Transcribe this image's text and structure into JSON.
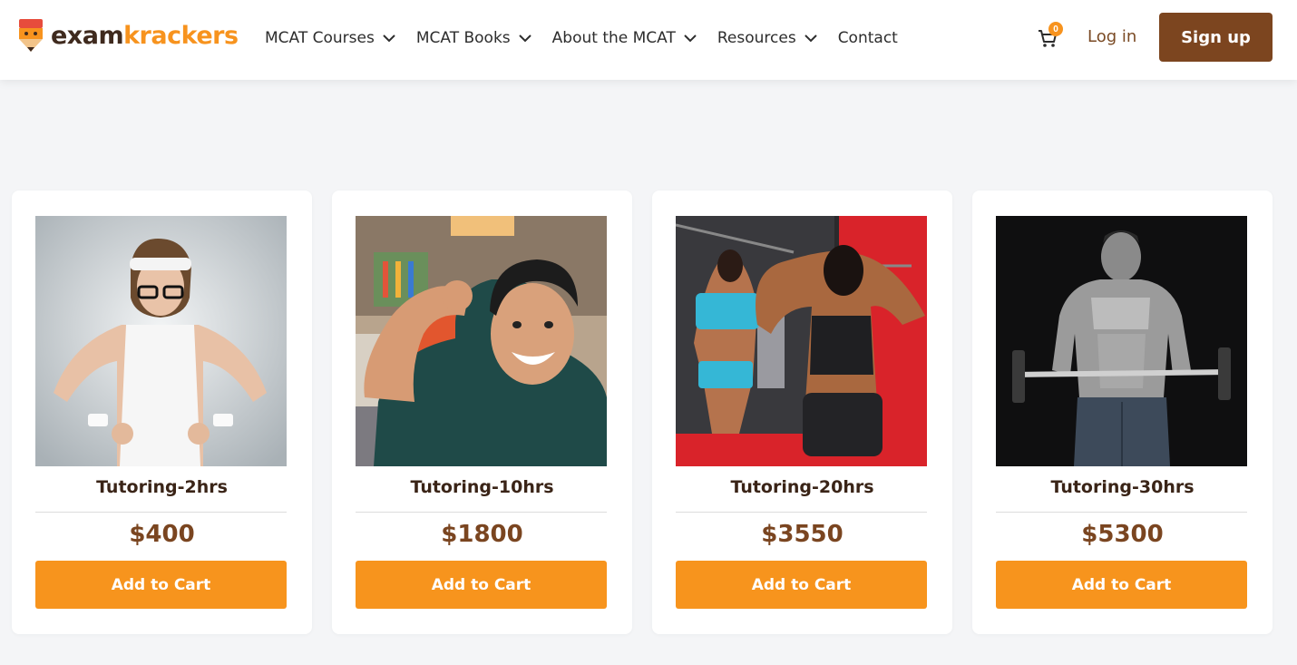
{
  "brand": {
    "name_part1": "exam",
    "name_part2": "krackers",
    "accent": "#f7931e",
    "dark": "#3f2a1e"
  },
  "nav": {
    "items": [
      {
        "label": "MCAT Courses",
        "has_dropdown": true
      },
      {
        "label": "MCAT Books",
        "has_dropdown": true
      },
      {
        "label": "About the MCAT",
        "has_dropdown": true
      },
      {
        "label": "Resources",
        "has_dropdown": true
      },
      {
        "label": "Contact",
        "has_dropdown": false
      }
    ],
    "cart_count": "0",
    "login_label": "Log in",
    "signup_label": "Sign up"
  },
  "products": [
    {
      "title": "Tutoring-2hrs",
      "price": "$400",
      "button_label": "Add to Cart",
      "image": "person-in-headband-flexing-photo"
    },
    {
      "title": "Tutoring-10hrs",
      "price": "$1800",
      "button_label": "Add to Cart",
      "image": "smiling-man-flexing-photo"
    },
    {
      "title": "Tutoring-20hrs",
      "price": "$3550",
      "button_label": "Add to Cart",
      "image": "women-at-gym-photo"
    },
    {
      "title": "Tutoring-30hrs",
      "price": "$5300",
      "button_label": "Add to Cart",
      "image": "bodybuilder-with-barbell-photo"
    }
  ],
  "colors": {
    "button": "#f7941d",
    "signup": "#7c451f",
    "price": "#7a4520",
    "background": "#f4f5f7"
  }
}
